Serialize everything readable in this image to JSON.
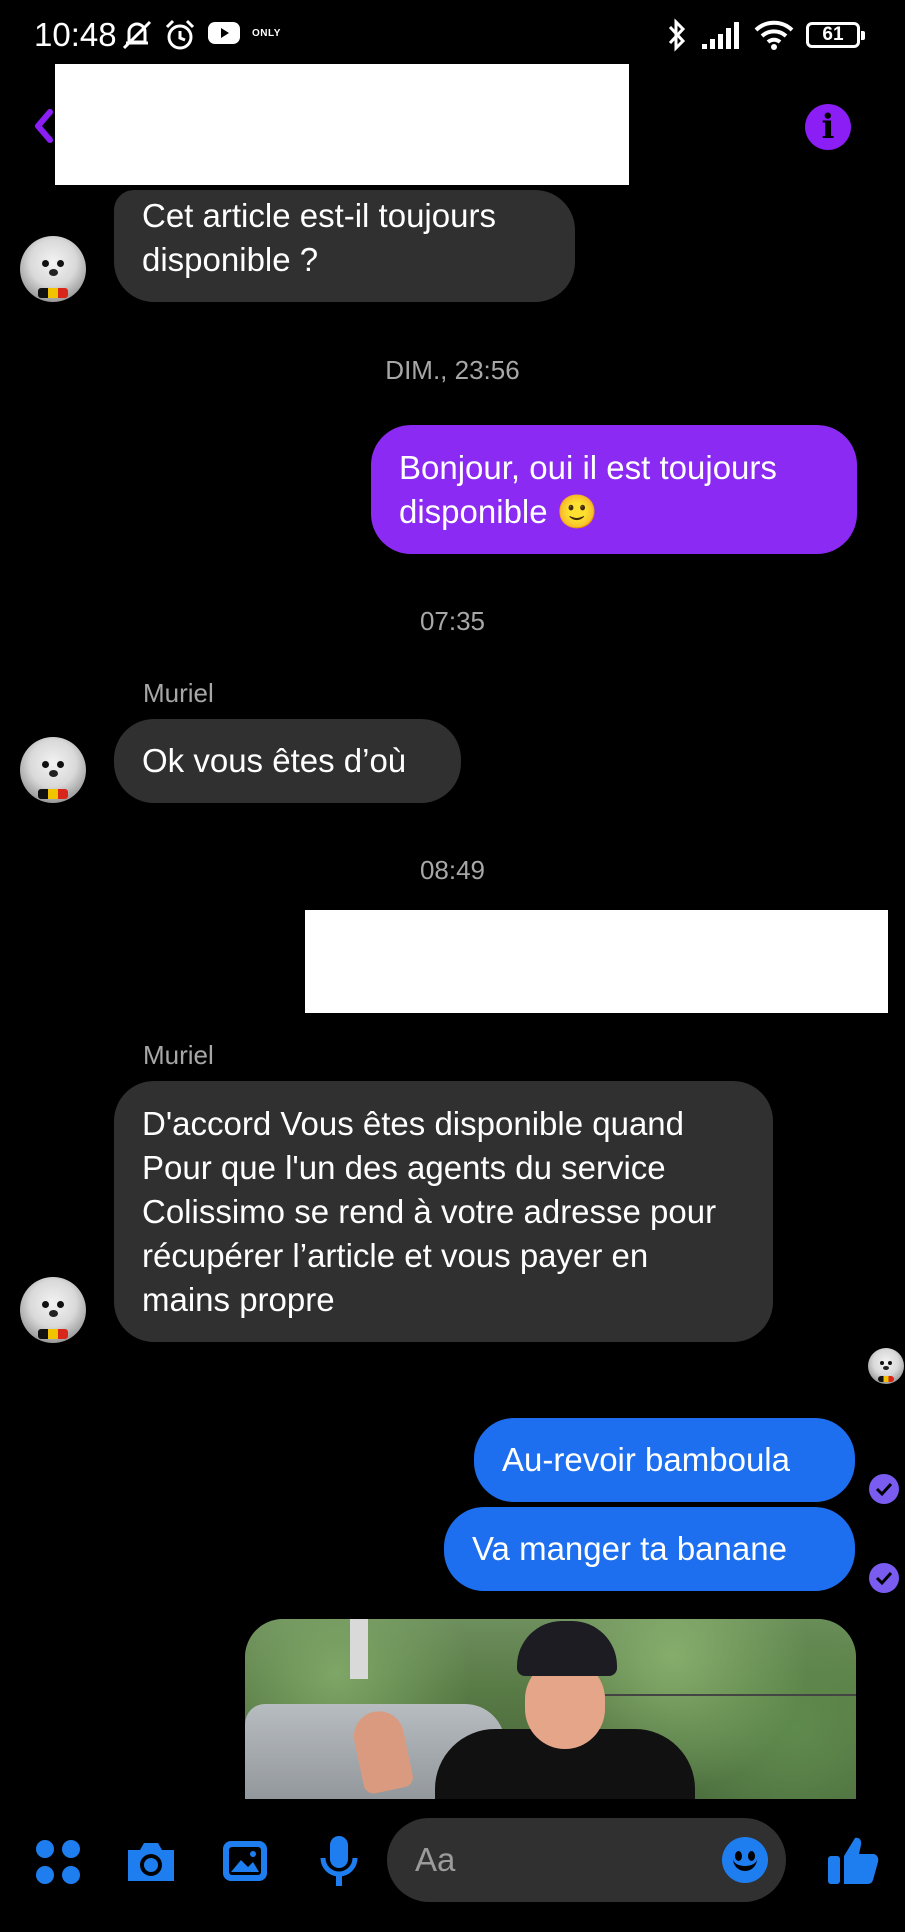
{
  "status_bar": {
    "time": "10:48",
    "only_label": "ONLY",
    "battery": "61",
    "icons": [
      "muted-bell-icon",
      "alarm-icon",
      "youtube-icon",
      "bluetooth-icon",
      "signal-icon",
      "wifi-icon",
      "battery-icon"
    ]
  },
  "header": {
    "back_icon": "back-arrow-icon",
    "info_icon": "info-icon"
  },
  "conversation": {
    "messages": [
      {
        "text": "Cet article est-il toujours disponible ?"
      },
      {
        "timestamp": "DIM., 23:56"
      },
      {
        "text": "Bonjour, oui il est toujours disponible 🙂"
      },
      {
        "timestamp": "07:35"
      },
      {
        "sender": "Muriel"
      },
      {
        "text": "Ok vous êtes d’où"
      },
      {
        "timestamp": "08:49"
      },
      {
        "sender": "Muriel"
      },
      {
        "text": "D'accord Vous êtes disponible quand Pour que l'un des agents du service Colissimo se rend à votre adresse pour récupérer l’article et vous payer en mains propre"
      },
      {
        "text": "Au-revoir bamboula"
      },
      {
        "text": "Va manger ta banane"
      }
    ]
  },
  "composer": {
    "placeholder": "Aa",
    "icons": [
      "apps-grid-icon",
      "camera-icon",
      "gallery-icon",
      "microphone-icon",
      "emoji-icon",
      "thumbs-up-icon"
    ]
  },
  "colors": {
    "background": "#000000",
    "incoming_bubble": "#303030",
    "outgoing_purple": "#8b2af3",
    "outgoing_blue": "#1e6ff0",
    "accent_icon_blue": "#1e7ef0",
    "accent_purple": "#8b1df5"
  }
}
